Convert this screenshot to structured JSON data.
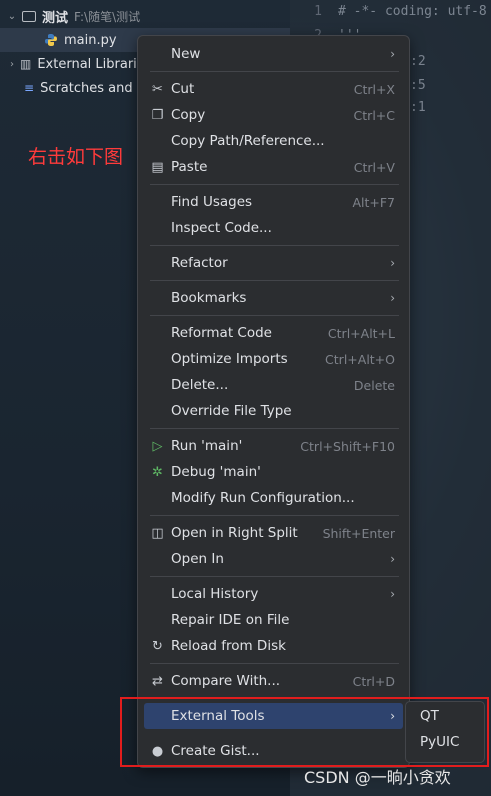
{
  "project_tree": {
    "root_name": "测试",
    "root_path": "F:\\随笔\\测试",
    "file_name": "main.py",
    "external_libraries": "External Librari",
    "scratches": "Scratches and"
  },
  "annotation": "右击如下图",
  "editor": {
    "line_numbers": [
      "1",
      "2"
    ],
    "line1": "# -*- coding: utf-8",
    "line2": "'''",
    "frag1": ":2",
    "frag2": ":5",
    "frag3": ":1"
  },
  "menu": {
    "new": "New",
    "cut": "Cut",
    "cut_sc": "Ctrl+X",
    "copy": "Copy",
    "copy_sc": "Ctrl+C",
    "copy_path": "Copy Path/Reference...",
    "paste": "Paste",
    "paste_sc": "Ctrl+V",
    "find_usages": "Find Usages",
    "find_usages_sc": "Alt+F7",
    "inspect_code": "Inspect Code...",
    "refactor": "Refactor",
    "bookmarks": "Bookmarks",
    "reformat": "Reformat Code",
    "reformat_sc": "Ctrl+Alt+L",
    "optimize": "Optimize Imports",
    "optimize_sc": "Ctrl+Alt+O",
    "delete": "Delete...",
    "delete_sc": "Delete",
    "override": "Override File Type",
    "run": "Run 'main'",
    "run_sc": "Ctrl+Shift+F10",
    "debug": "Debug 'main'",
    "modify_run": "Modify Run Configuration...",
    "open_right": "Open in Right Split",
    "open_right_sc": "Shift+Enter",
    "open_in": "Open In",
    "local_history": "Local History",
    "repair": "Repair IDE on File",
    "reload": "Reload from Disk",
    "compare": "Compare With...",
    "compare_sc": "Ctrl+D",
    "external_tools": "External Tools",
    "create_gist": "Create Gist..."
  },
  "submenu": {
    "items": [
      "QT",
      "PyUIC"
    ]
  },
  "watermark": "CSDN @一晌小贪欢"
}
